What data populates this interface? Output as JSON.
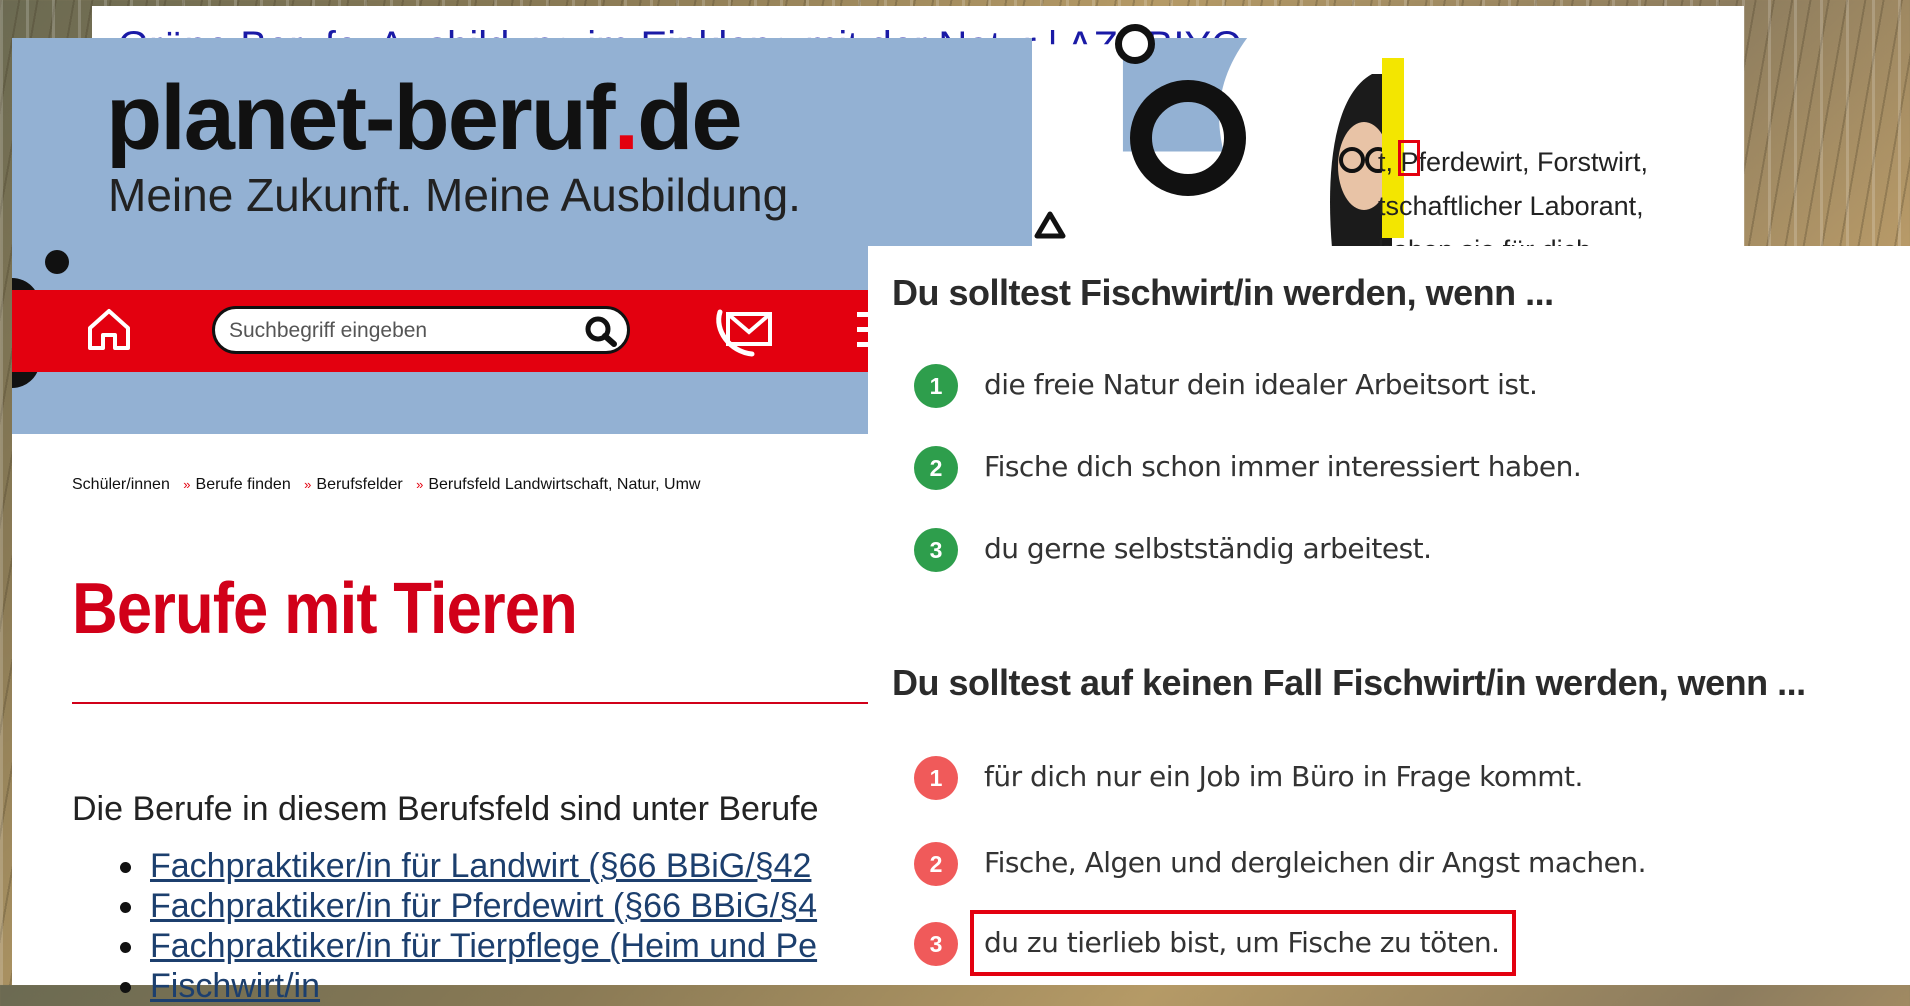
{
  "background_page": {
    "title": "Grüne Berufe: Ausbildung im Einklang mit der Natur | AZUBIYO"
  },
  "planet": {
    "logo_main": "planet-beruf",
    "logo_dot": ".",
    "logo_tld": "de",
    "tagline": "Meine Zukunft. Meine Ausbildung.",
    "search_placeholder": "Suchbegriff eingeben",
    "breadcrumb": [
      "Schüler/innen",
      "Berufe finden",
      "Berufsfelder",
      "Berufsfeld Landwirtschaft, Natur, Umw"
    ],
    "breadcrumb_sep": "»",
    "page_title": "Berufe mit Tieren",
    "intro": "Die Berufe in diesem Berufsfeld sind unter Berufe",
    "jobs": [
      "Fachpraktiker/in für Landwirt (§66 BBiG/§42",
      "Fachpraktiker/in für Pferdewirt (§66 BBiG/§4",
      "Fachpraktiker/in für Tierpflege (Heim und Pe",
      "Fischwirt/in"
    ],
    "brand_red": "#e3000f",
    "header_blue": "#93b1d3"
  },
  "partial_text": {
    "line1": "t, Pferdewirt, Forstwirt,",
    "line2": "tschaftlicher Laborant,",
    "line3": "haben sie für dich"
  },
  "overlay": {
    "heading_yes": "Du solltest Fischwirt/in werden, wenn ...",
    "yes_items": [
      {
        "num": "1",
        "text": "die freie Natur dein idealer Arbeitsort ist."
      },
      {
        "num": "2",
        "text": "Fische dich schon immer interessiert haben."
      },
      {
        "num": "3",
        "text": "du gerne selbstständig arbeitest."
      }
    ],
    "heading_no": "Du solltest auf keinen Fall Fischwirt/in werden, wenn ...",
    "no_items": [
      {
        "num": "1",
        "text": "für dich nur ein Job im Büro in Frage kommt."
      },
      {
        "num": "2",
        "text": "Fische, Algen und dergleichen dir Angst machen."
      },
      {
        "num": "3",
        "text": "du zu tierlieb bist, um Fische zu töten."
      }
    ],
    "green": "#2e9e4c",
    "red": "#f05a5a"
  }
}
